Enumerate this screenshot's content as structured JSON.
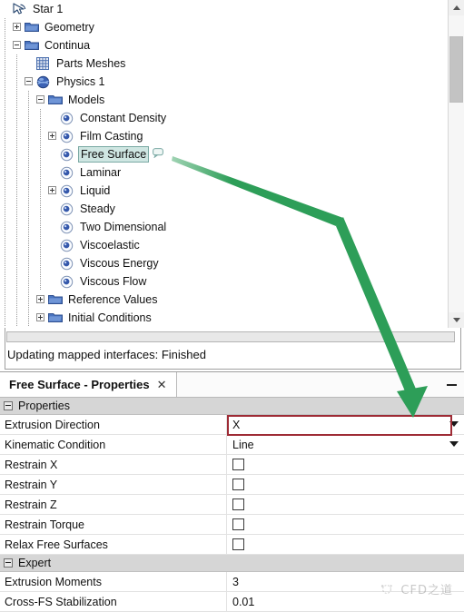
{
  "tree": {
    "nodes": [
      {
        "label": "Star 1",
        "depth": 0,
        "icon": "star-cursor-icon",
        "twisty": "none",
        "selected": false
      },
      {
        "label": "Geometry",
        "depth": 1,
        "icon": "folder-icon",
        "twisty": "plus",
        "selected": false
      },
      {
        "label": "Continua",
        "depth": 1,
        "icon": "folder-icon",
        "twisty": "minus",
        "selected": false
      },
      {
        "label": "Parts Meshes",
        "depth": 2,
        "icon": "grid-mesh-icon",
        "twisty": "none",
        "selected": false
      },
      {
        "label": "Physics 1",
        "depth": 2,
        "icon": "physics-sphere-icon",
        "twisty": "minus",
        "selected": false
      },
      {
        "label": "Models",
        "depth": 3,
        "icon": "folder-icon",
        "twisty": "minus",
        "selected": false
      },
      {
        "label": "Constant Density",
        "depth": 4,
        "icon": "model-node-icon",
        "twisty": "none",
        "selected": false
      },
      {
        "label": "Film Casting",
        "depth": 4,
        "icon": "model-node-icon",
        "twisty": "plus",
        "selected": false
      },
      {
        "label": "Free Surface",
        "depth": 4,
        "icon": "model-node-icon",
        "twisty": "none",
        "selected": true
      },
      {
        "label": "Laminar",
        "depth": 4,
        "icon": "model-node-icon",
        "twisty": "none",
        "selected": false
      },
      {
        "label": "Liquid",
        "depth": 4,
        "icon": "model-node-icon",
        "twisty": "plus",
        "selected": false
      },
      {
        "label": "Steady",
        "depth": 4,
        "icon": "model-node-icon",
        "twisty": "none",
        "selected": false
      },
      {
        "label": "Two Dimensional",
        "depth": 4,
        "icon": "model-node-icon",
        "twisty": "none",
        "selected": false
      },
      {
        "label": "Viscoelastic",
        "depth": 4,
        "icon": "model-node-icon",
        "twisty": "none",
        "selected": false
      },
      {
        "label": "Viscous Energy",
        "depth": 4,
        "icon": "model-node-icon",
        "twisty": "none",
        "selected": false
      },
      {
        "label": "Viscous Flow",
        "depth": 4,
        "icon": "model-node-icon",
        "twisty": "none",
        "selected": false
      },
      {
        "label": "Reference Values",
        "depth": 3,
        "icon": "folder-icon",
        "twisty": "plus",
        "selected": false
      },
      {
        "label": "Initial Conditions",
        "depth": 3,
        "icon": "folder-icon",
        "twisty": "plus",
        "selected": false
      }
    ]
  },
  "status": {
    "message": "Updating mapped interfaces: Finished",
    "progress_percent": 0
  },
  "properties_panel": {
    "tab_title": "Free Surface - Properties",
    "tab_close_glyph": "✕",
    "minimize_label": "",
    "groups": [
      {
        "name": "Properties",
        "rows": [
          {
            "name": "Extrusion Direction",
            "value": "X",
            "type": "dropdown",
            "highlighted": true
          },
          {
            "name": "Kinematic Condition",
            "value": "Line",
            "type": "dropdown",
            "highlighted": false
          },
          {
            "name": "Restrain X",
            "value": "",
            "type": "checkbox",
            "checked": false,
            "highlighted": false
          },
          {
            "name": "Restrain Y",
            "value": "",
            "type": "checkbox",
            "checked": false,
            "highlighted": false
          },
          {
            "name": "Restrain Z",
            "value": "",
            "type": "checkbox",
            "checked": false,
            "highlighted": false
          },
          {
            "name": "Restrain Torque",
            "value": "",
            "type": "checkbox",
            "checked": false,
            "highlighted": false
          },
          {
            "name": "Relax Free Surfaces",
            "value": "",
            "type": "checkbox",
            "checked": false,
            "highlighted": false
          }
        ]
      },
      {
        "name": "Expert",
        "rows": [
          {
            "name": "Extrusion Moments",
            "value": "3",
            "type": "text",
            "highlighted": false
          },
          {
            "name": "Cross-FS Stabilization",
            "value": "0.01",
            "type": "text",
            "highlighted": false
          }
        ]
      }
    ]
  },
  "annotation": {
    "arrow_color": "#2d9e58",
    "highlight_box_color": "#9e2b35"
  },
  "watermark": {
    "text": "CFD之道"
  },
  "scrollbar": {
    "up_glyph": "▲",
    "down_glyph": "▼"
  }
}
